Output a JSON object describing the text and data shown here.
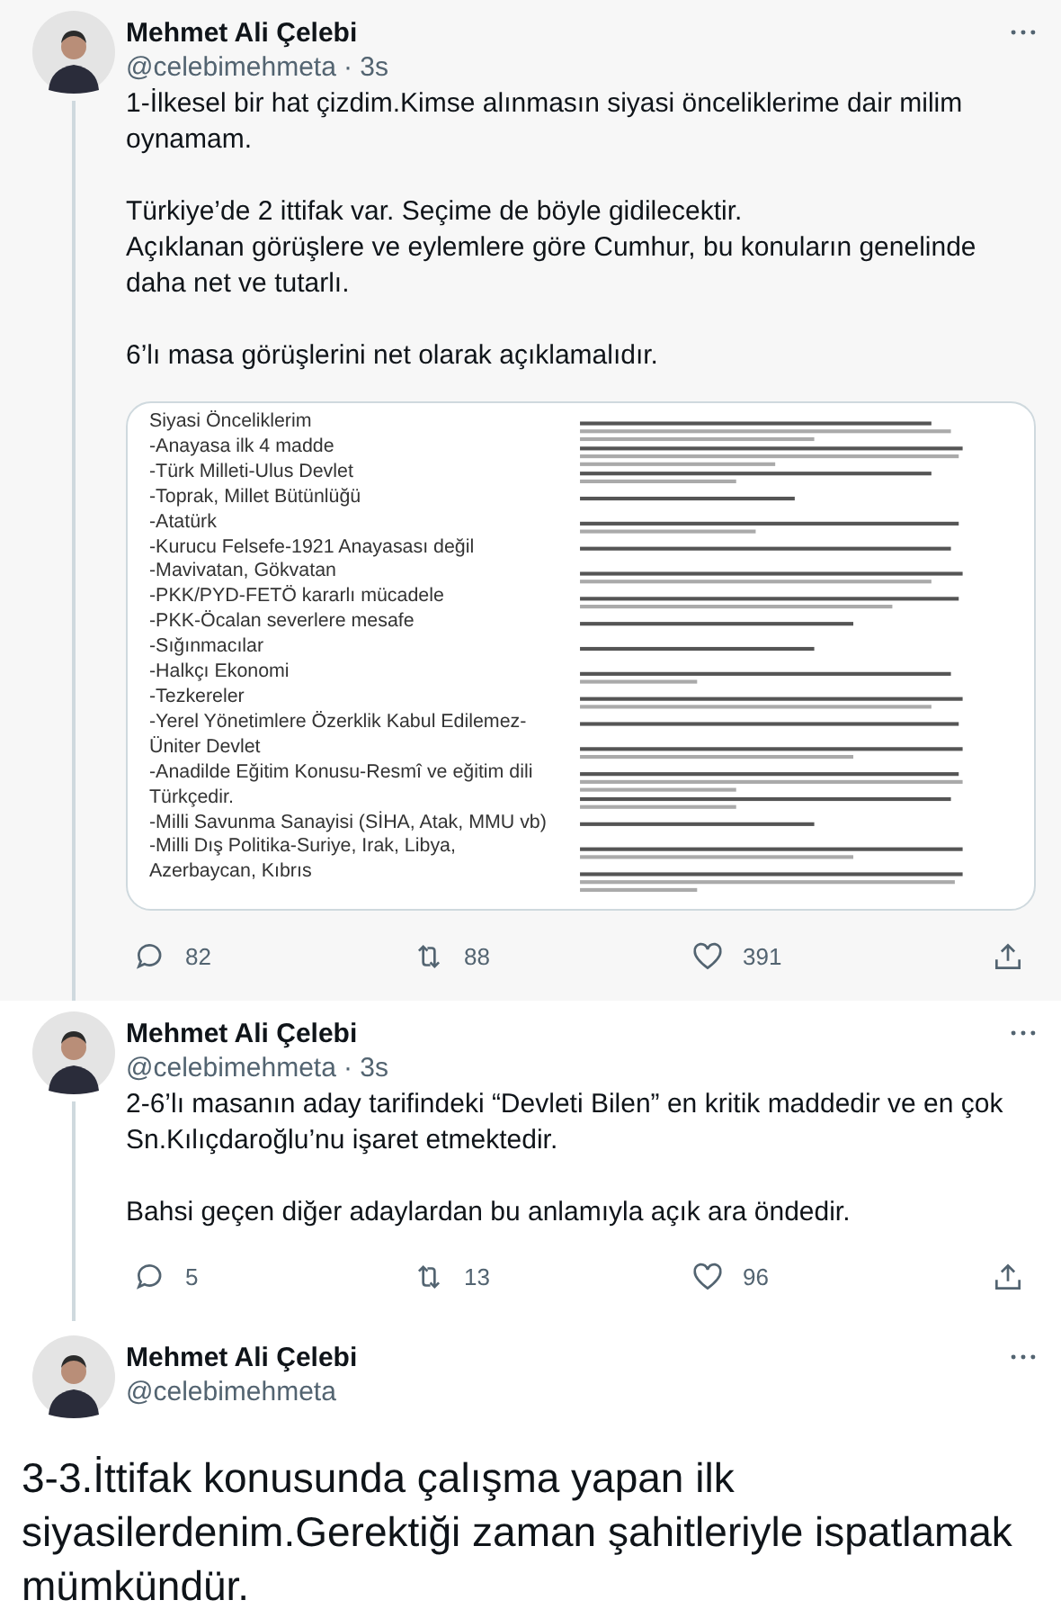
{
  "tweets": [
    {
      "kind": "thread",
      "thread_line": true,
      "name": "Mehmet Ali Çelebi",
      "handle": "@celebimehmeta",
      "time": "· 3s",
      "paragraphs": [
        "1-İlkesel bir hat çizdim.Kimse alınmasın siyasi önceliklerime dair milim oynamam.",
        "Türkiye’de 2 ittifak var. Seçime de böyle gidilecektir.\nAçıklanan görüşlere ve eylemlere göre Cumhur, bu konuların genelinde daha net ve tutarlı.",
        "6’lı masa görüşlerini net olarak açıklamalıdır."
      ],
      "attachment": {
        "list_title": "Siyasi Önceliklerim",
        "list_items": [
          "-Anayasa ilk 4 madde",
          "-Türk Milleti-Ulus Devlet",
          "-Toprak, Millet Bütünlüğü",
          "-Atatürk",
          "-Kurucu Felsefe-1921 Anayasası değil",
          "-Mavivatan, Gökvatan",
          "-PKK/PYD-FETÖ kararlı mücadele",
          "-PKK-Öcalan severlere mesafe",
          "-Sığınmacılar",
          "-Halkçı Ekonomi",
          "-Tezkereler",
          "-Yerel Yönetimlere Özerklik Kabul Edilemez-Üniter Devlet",
          "-Anadilde Eğitim Konusu-Resmî ve eğitim dili Türkçedir.",
          "-Milli Savunma Sanayisi (SİHA, Atak, MMU vb)",
          "-Milli Dış Politika-Suriye, Irak, Libya, Azerbaycan, Kıbrıs"
        ]
      },
      "stats": {
        "replies": "82",
        "retweets": "88",
        "likes": "391"
      }
    },
    {
      "kind": "thread",
      "thread_line": true,
      "name": "Mehmet Ali Çelebi",
      "handle": "@celebimehmeta",
      "time": "· 3s",
      "paragraphs": [
        "2-6’lı masanın aday tarifindeki “Devleti Bilen” en kritik maddedir ve en çok Sn.Kılıçdaroğlu’nu işaret etmektedir.",
        "Bahsi geçen diğer adaylardan bu anlamıyla açık ara öndedir."
      ],
      "stats": {
        "replies": "5",
        "retweets": "13",
        "likes": "96"
      }
    },
    {
      "kind": "focused",
      "name": "Mehmet Ali Çelebi",
      "handle": "@celebimehmeta",
      "paragraphs": [
        "3-3.İttifak konusunda çalışma yapan ilk siyasilerdenim.Gerektiği zaman şahitleriyle ispatlamak mümkündür."
      ]
    }
  ]
}
